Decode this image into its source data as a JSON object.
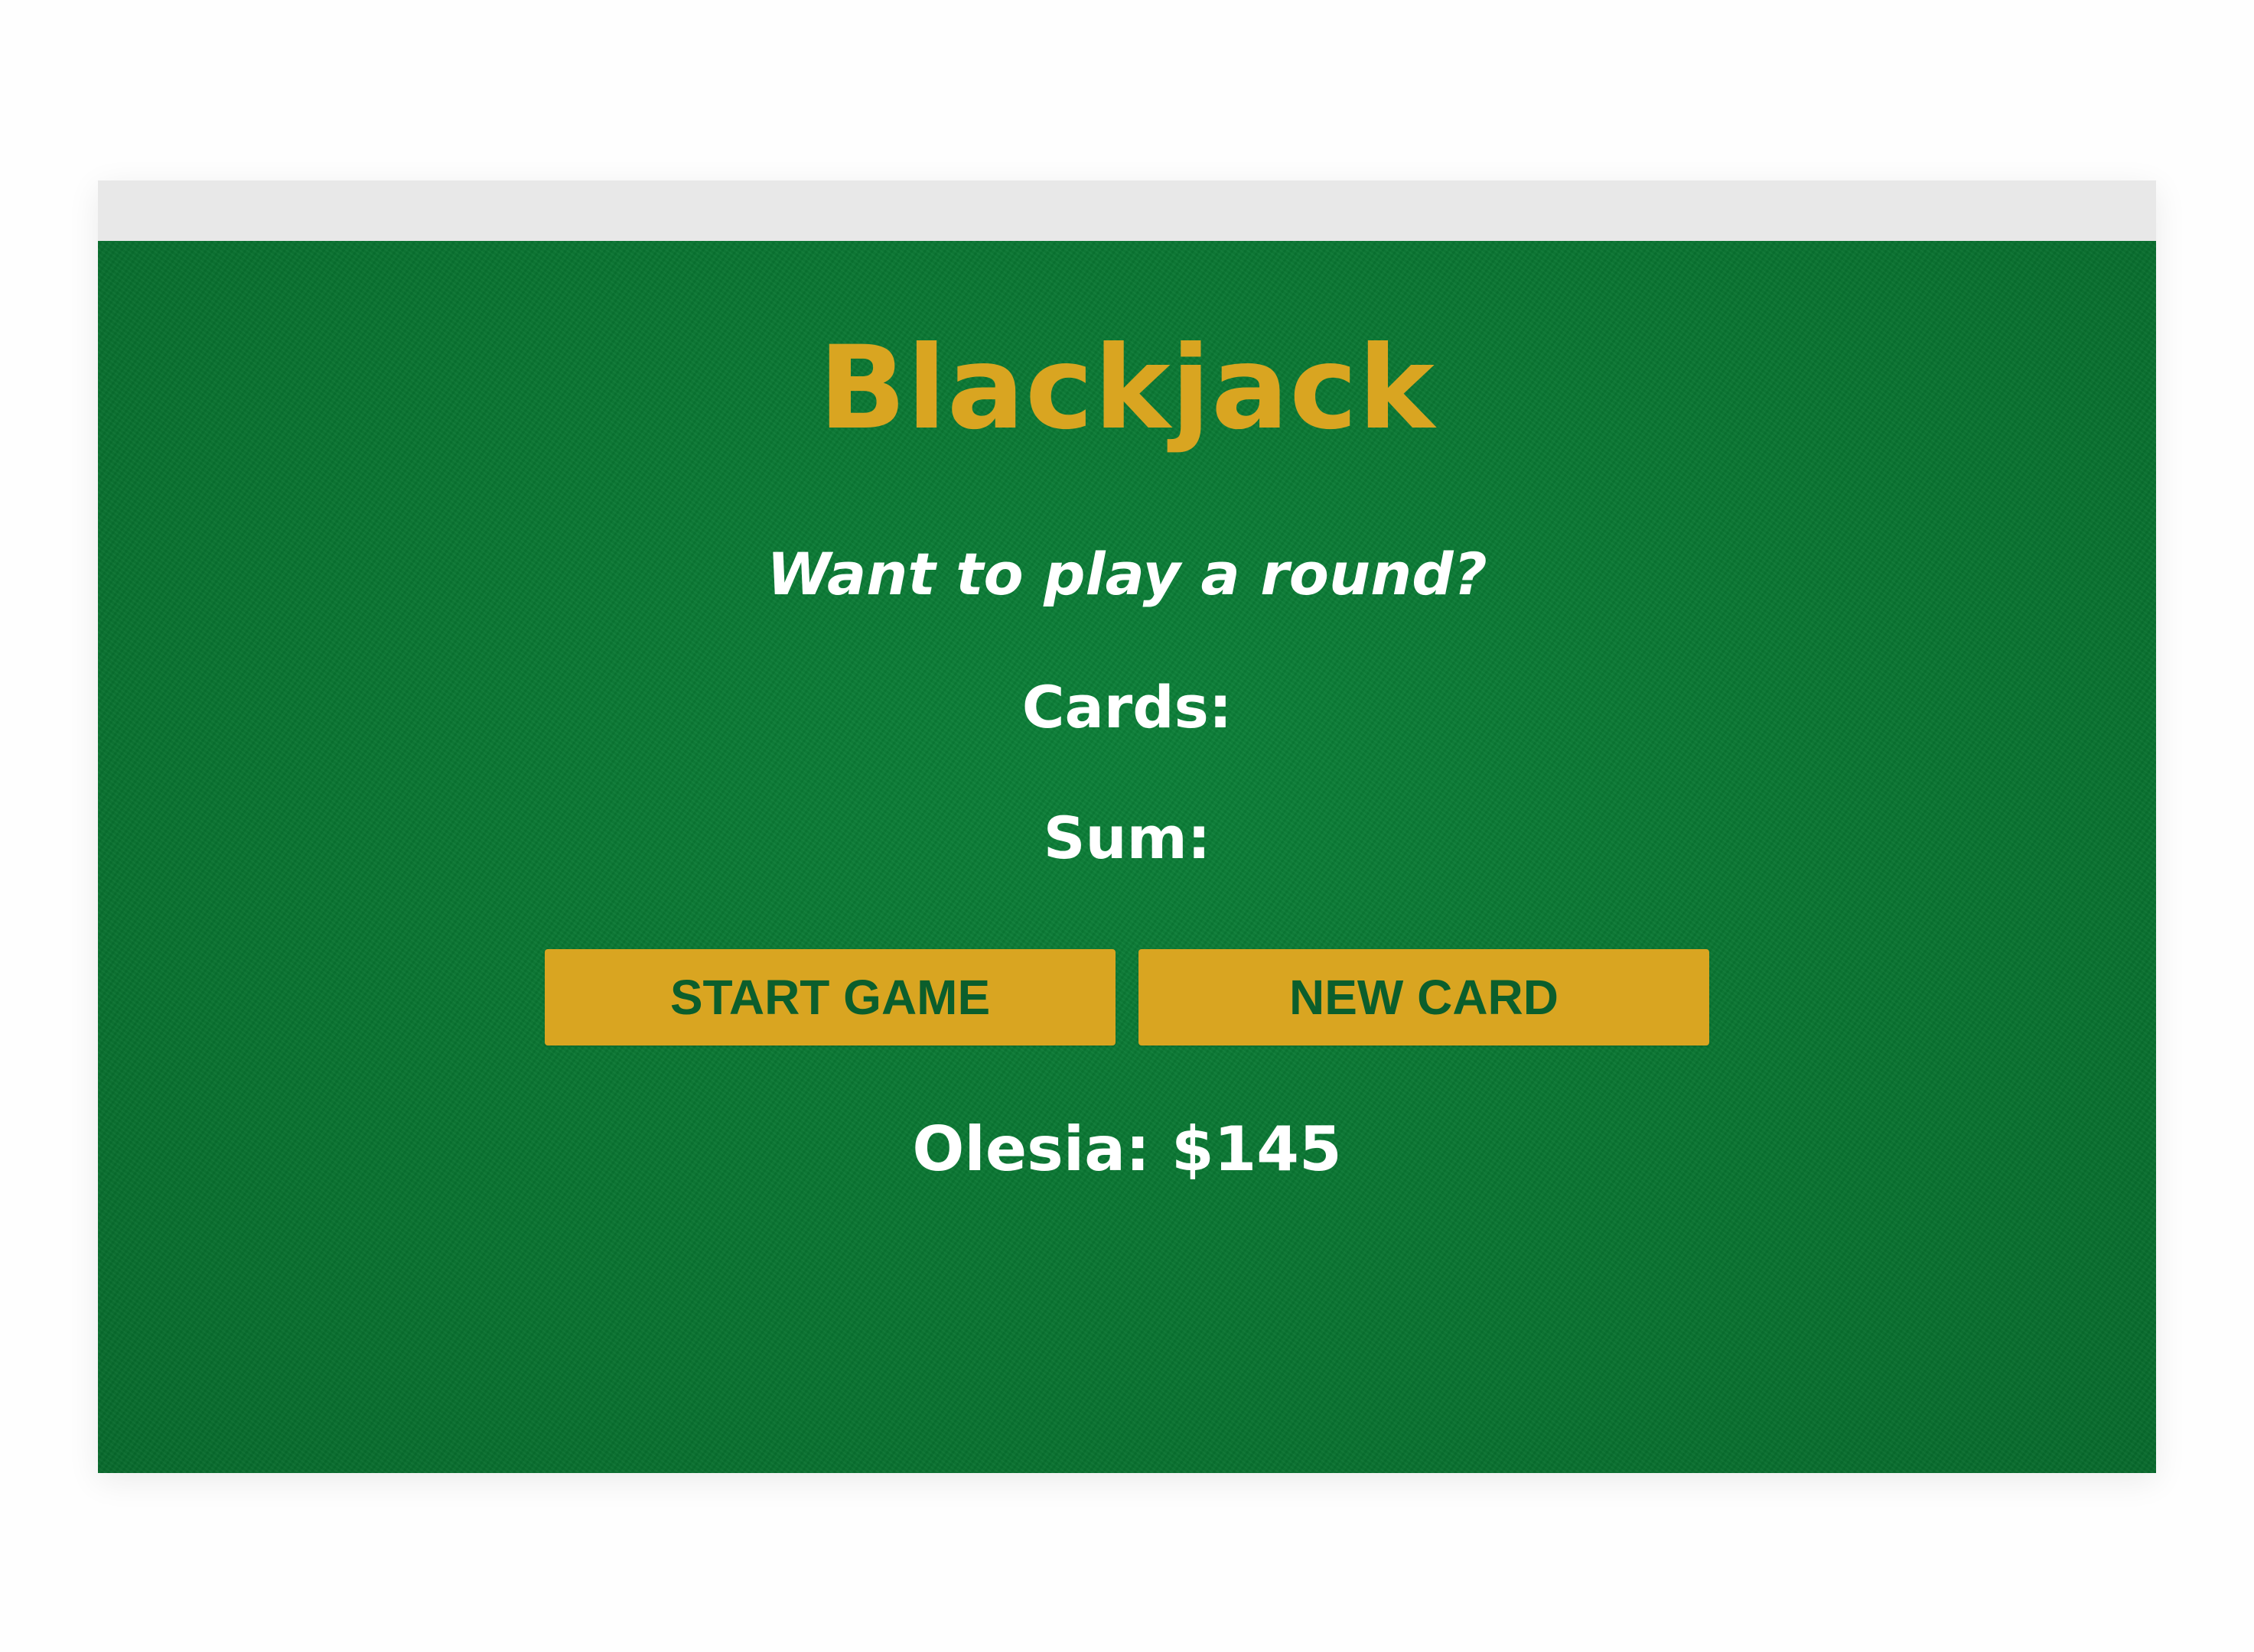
{
  "game": {
    "title": "Blackjack",
    "message": "Want to play a round?",
    "cards_label": "Cards:",
    "sum_label": "Sum:",
    "start_button_label": "START GAME",
    "new_card_button_label": "NEW CARD",
    "player_info": "Olesia: $145"
  },
  "colors": {
    "felt_green": "#0a7a35",
    "accent_gold": "#d9a521",
    "button_text_green": "#0b5e2c",
    "text_white": "#ffffff"
  }
}
